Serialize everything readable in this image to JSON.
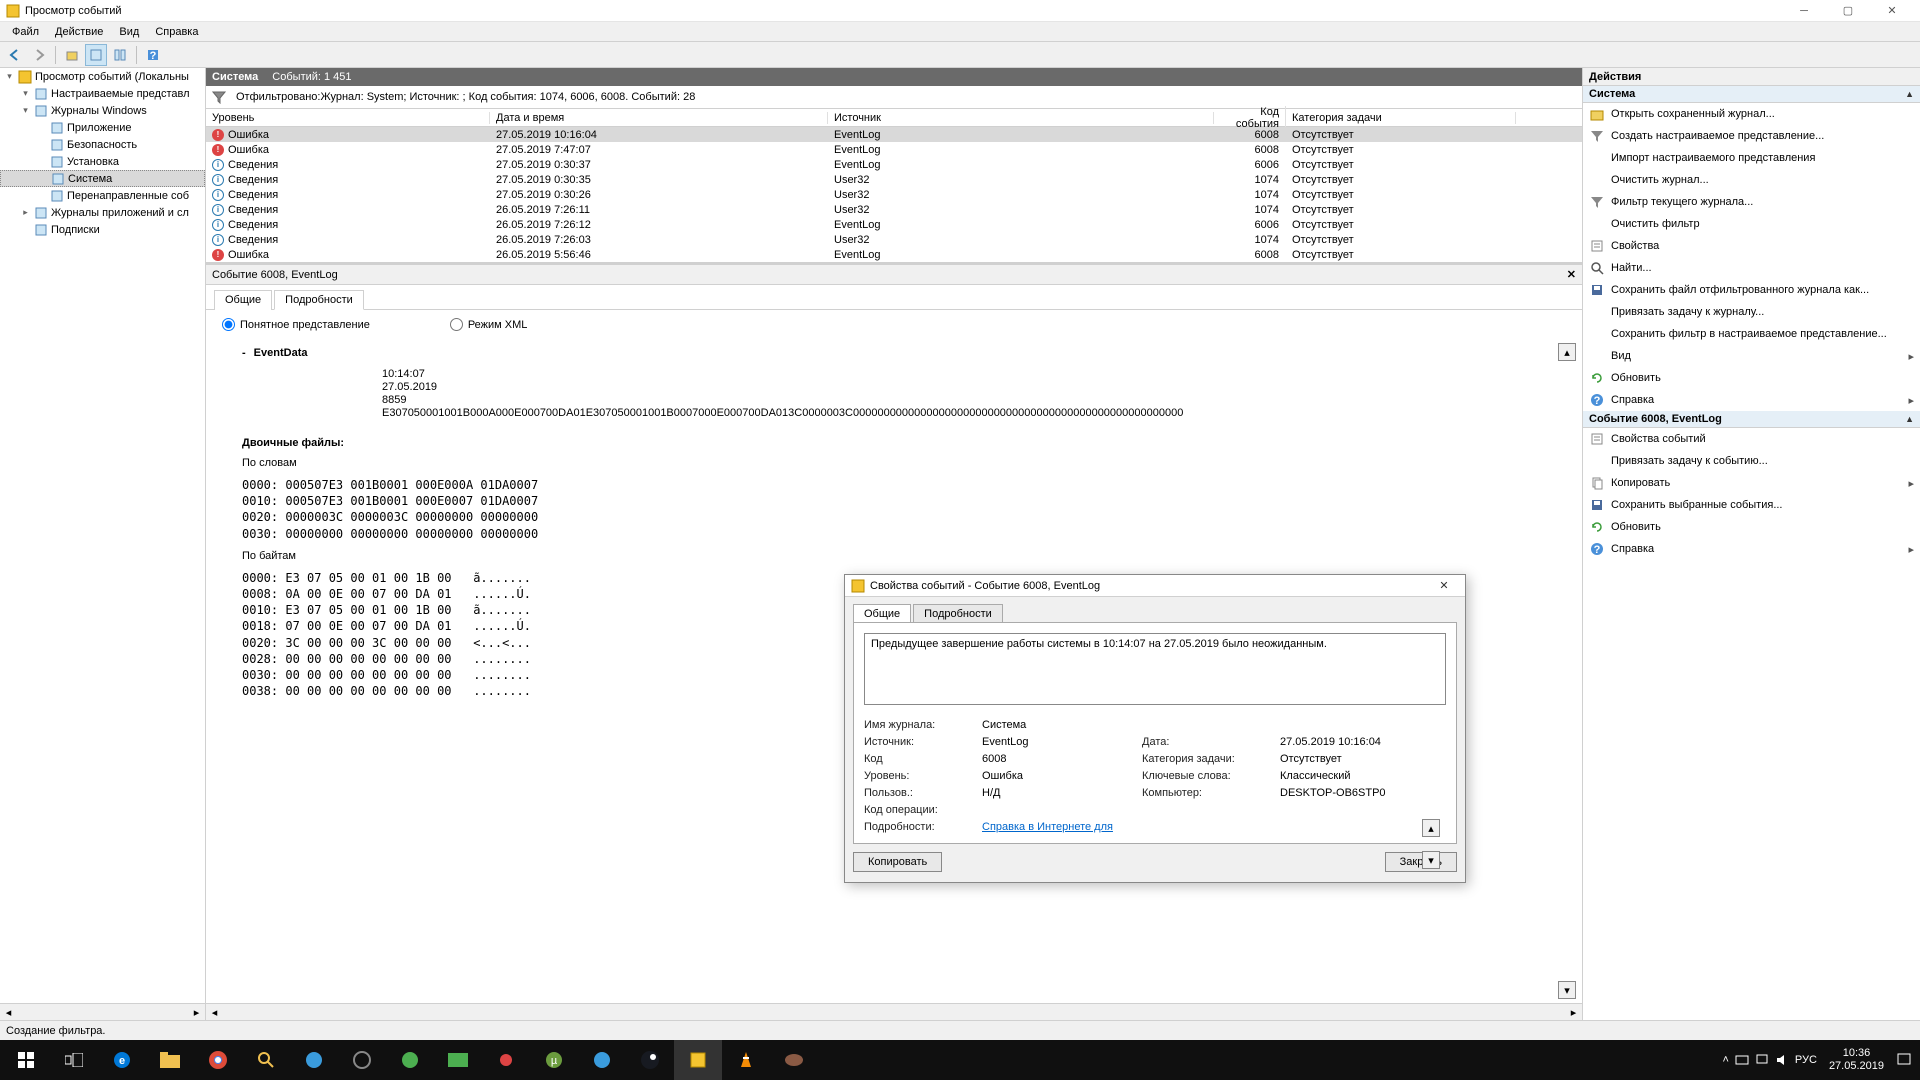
{
  "window_title": "Просмотр событий",
  "menu": [
    "Файл",
    "Действие",
    "Вид",
    "Справка"
  ],
  "tree": {
    "root": "Просмотр событий (Локальны",
    "items": [
      {
        "level": 1,
        "exp": "▾",
        "label": "Настраиваемые представл"
      },
      {
        "level": 1,
        "exp": "▾",
        "label": "Журналы Windows"
      },
      {
        "level": 2,
        "exp": "",
        "label": "Приложение"
      },
      {
        "level": 2,
        "exp": "",
        "label": "Безопасность"
      },
      {
        "level": 2,
        "exp": "",
        "label": "Установка"
      },
      {
        "level": 2,
        "exp": "",
        "label": "Система",
        "sel": true
      },
      {
        "level": 2,
        "exp": "",
        "label": "Перенаправленные соб"
      },
      {
        "level": 1,
        "exp": "▸",
        "label": "Журналы приложений и сл"
      },
      {
        "level": 1,
        "exp": "",
        "label": "Подписки"
      }
    ]
  },
  "center_header": {
    "name": "Система",
    "count": "Событий: 1 451"
  },
  "filter_text": "Отфильтровано:Журнал: System; Источник: ; Код события: 1074, 6006, 6008. Событий: 28",
  "columns": {
    "level": "Уровень",
    "date": "Дата и время",
    "src": "Источник",
    "id": "Код события",
    "cat": "Категория задачи"
  },
  "events": [
    {
      "lvl": "err",
      "lvltxt": "Ошибка",
      "dt": "27.05.2019 10:16:04",
      "src": "EventLog",
      "id": "6008",
      "cat": "Отсутствует",
      "sel": true
    },
    {
      "lvl": "err",
      "lvltxt": "Ошибка",
      "dt": "27.05.2019 7:47:07",
      "src": "EventLog",
      "id": "6008",
      "cat": "Отсутствует"
    },
    {
      "lvl": "info",
      "lvltxt": "Сведения",
      "dt": "27.05.2019 0:30:37",
      "src": "EventLog",
      "id": "6006",
      "cat": "Отсутствует"
    },
    {
      "lvl": "info",
      "lvltxt": "Сведения",
      "dt": "27.05.2019 0:30:35",
      "src": "User32",
      "id": "1074",
      "cat": "Отсутствует"
    },
    {
      "lvl": "info",
      "lvltxt": "Сведения",
      "dt": "27.05.2019 0:30:26",
      "src": "User32",
      "id": "1074",
      "cat": "Отсутствует"
    },
    {
      "lvl": "info",
      "lvltxt": "Сведения",
      "dt": "26.05.2019 7:26:11",
      "src": "User32",
      "id": "1074",
      "cat": "Отсутствует"
    },
    {
      "lvl": "info",
      "lvltxt": "Сведения",
      "dt": "26.05.2019 7:26:12",
      "src": "EventLog",
      "id": "6006",
      "cat": "Отсутствует"
    },
    {
      "lvl": "info",
      "lvltxt": "Сведения",
      "dt": "26.05.2019 7:26:03",
      "src": "User32",
      "id": "1074",
      "cat": "Отсутствует"
    },
    {
      "lvl": "err",
      "lvltxt": "Ошибка",
      "dt": "26.05.2019 5:56:46",
      "src": "EventLog",
      "id": "6008",
      "cat": "Отсутствует"
    }
  ],
  "detail_title": "Событие 6008, EventLog",
  "detail_tabs": {
    "general": "Общие",
    "details": "Подробности"
  },
  "radio": {
    "friendly": "Понятное представление",
    "xml": "Режим XML"
  },
  "event_data_title": "EventData",
  "event_data": [
    "10:14:07",
    "27.05.2019",
    "8859",
    "E307050001001B000A000E000700DA01E307050001001B0007000E000700DA013C0000003C000000000000000000000000000000000000000000000000000000"
  ],
  "binary_title": "Двоичные файлы:",
  "by_words": "По словам",
  "by_bytes": "По байтам",
  "hex_words": "0000: 000507E3 001B0001 000E000A 01DA0007\n0010: 000507E3 001B0001 000E0007 01DA0007\n0020: 0000003C 0000003C 00000000 00000000\n0030: 00000000 00000000 00000000 00000000",
  "hex_bytes": "0000: E3 07 05 00 01 00 1B 00   ã.......\n0008: 0A 00 0E 00 07 00 DA 01   ......Ú.\n0010: E3 07 05 00 01 00 1B 00   ã.......\n0018: 07 00 0E 00 07 00 DA 01   ......Ú.\n0020: 3C 00 00 00 3C 00 00 00   <...<...\n0028: 00 00 00 00 00 00 00 00   ........\n0030: 00 00 00 00 00 00 00 00   ........\n0038: 00 00 00 00 00 00 00 00   ........",
  "actions_title": "Действия",
  "act_groups": [
    {
      "name": "Система",
      "items": [
        {
          "icon": "open",
          "label": "Открыть сохраненный журнал..."
        },
        {
          "icon": "filter",
          "label": "Создать настраиваемое представление..."
        },
        {
          "icon": "",
          "label": "Импорт настраиваемого представления"
        },
        {
          "icon": "",
          "label": "Очистить журнал..."
        },
        {
          "icon": "filter",
          "label": "Фильтр текущего журнала..."
        },
        {
          "icon": "",
          "label": "Очистить фильтр"
        },
        {
          "icon": "props",
          "label": "Свойства"
        },
        {
          "icon": "find",
          "label": "Найти..."
        },
        {
          "icon": "save",
          "label": "Сохранить файл отфильтрованного журнала как..."
        },
        {
          "icon": "",
          "label": "Привязать задачу к журналу..."
        },
        {
          "icon": "",
          "label": "Сохранить фильтр в настраиваемое представление..."
        },
        {
          "icon": "",
          "label": "Вид",
          "arrow": true
        },
        {
          "icon": "refresh",
          "label": "Обновить"
        },
        {
          "icon": "help",
          "label": "Справка",
          "arrow": true
        }
      ]
    },
    {
      "name": "Событие 6008, EventLog",
      "items": [
        {
          "icon": "props",
          "label": "Свойства событий"
        },
        {
          "icon": "",
          "label": "Привязать задачу к событию..."
        },
        {
          "icon": "copy",
          "label": "Копировать",
          "arrow": true
        },
        {
          "icon": "save",
          "label": "Сохранить выбранные события..."
        },
        {
          "icon": "refresh",
          "label": "Обновить"
        },
        {
          "icon": "help",
          "label": "Справка",
          "arrow": true
        }
      ]
    }
  ],
  "status": "Создание фильтра.",
  "dialog": {
    "title": "Свойства событий - Событие 6008, EventLog",
    "tabs": {
      "general": "Общие",
      "details": "Подробности"
    },
    "message": "Предыдущее завершение работы системы в 10:14:07 на 27.05.2019 было неожиданным.",
    "rows": {
      "logname_l": "Имя журнала:",
      "logname_v": "Система",
      "src_l": "Источник:",
      "src_v": "EventLog",
      "date_l": "Дата:",
      "date_v": "27.05.2019 10:16:04",
      "id_l": "Код",
      "id_v": "6008",
      "cat_l": "Категория задачи:",
      "cat_v": "Отсутствует",
      "lvl_l": "Уровень:",
      "lvl_v": "Ошибка",
      "kw_l": "Ключевые слова:",
      "kw_v": "Классический",
      "user_l": "Пользов.:",
      "user_v": "Н/Д",
      "comp_l": "Компьютер:",
      "comp_v": "DESKTOP-OB6STP0",
      "op_l": "Код операции:",
      "op_v": "",
      "info_l": "Подробности:",
      "info_v": "Справка в Интернете для "
    },
    "copy": "Копировать",
    "close": "Закрыть"
  },
  "tray": {
    "lang": "РУС",
    "time": "10:36",
    "date": "27.05.2019"
  }
}
